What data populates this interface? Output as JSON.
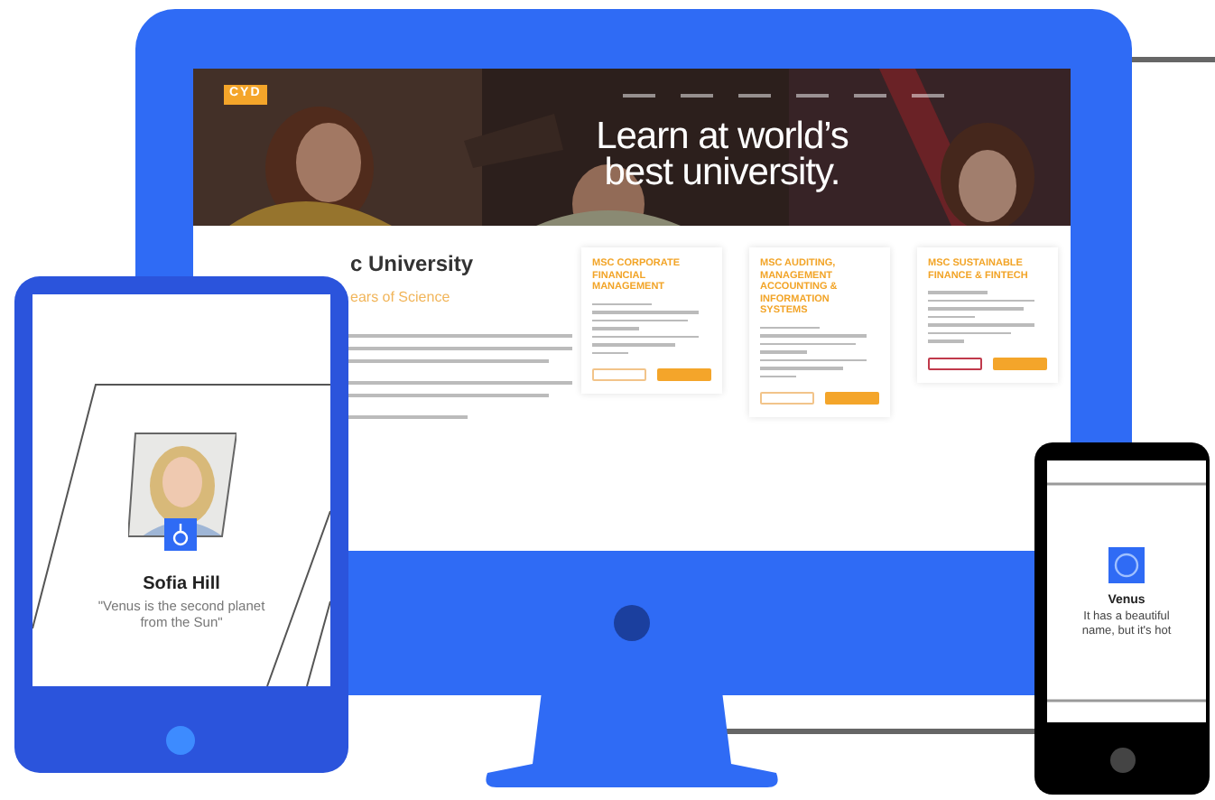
{
  "monitor": {
    "site": {
      "logo": "CYD",
      "hero": {
        "headline": [
          "Learn at world’s",
          "best university."
        ]
      },
      "heading": "c University",
      "subheading": "ears of Science",
      "courses": [
        {
          "title": "MSC CORPORATE FINANCIAL MANAGEMENT",
          "highlighted": false
        },
        {
          "title": "MSC AUDITING, MANAGEMENT ACCOUNTING & INFORMATION SYSTEMS",
          "highlighted": false
        },
        {
          "title": "MSC SUSTAINABLE FINANCE & FINTECH",
          "highlighted": true
        }
      ]
    }
  },
  "tablet": {
    "name": "Sofia Hill",
    "quote": "\"Venus is the second planet from the Sun\""
  },
  "phone": {
    "title": "Venus",
    "text": "It has a beautiful name, but it's hot"
  }
}
